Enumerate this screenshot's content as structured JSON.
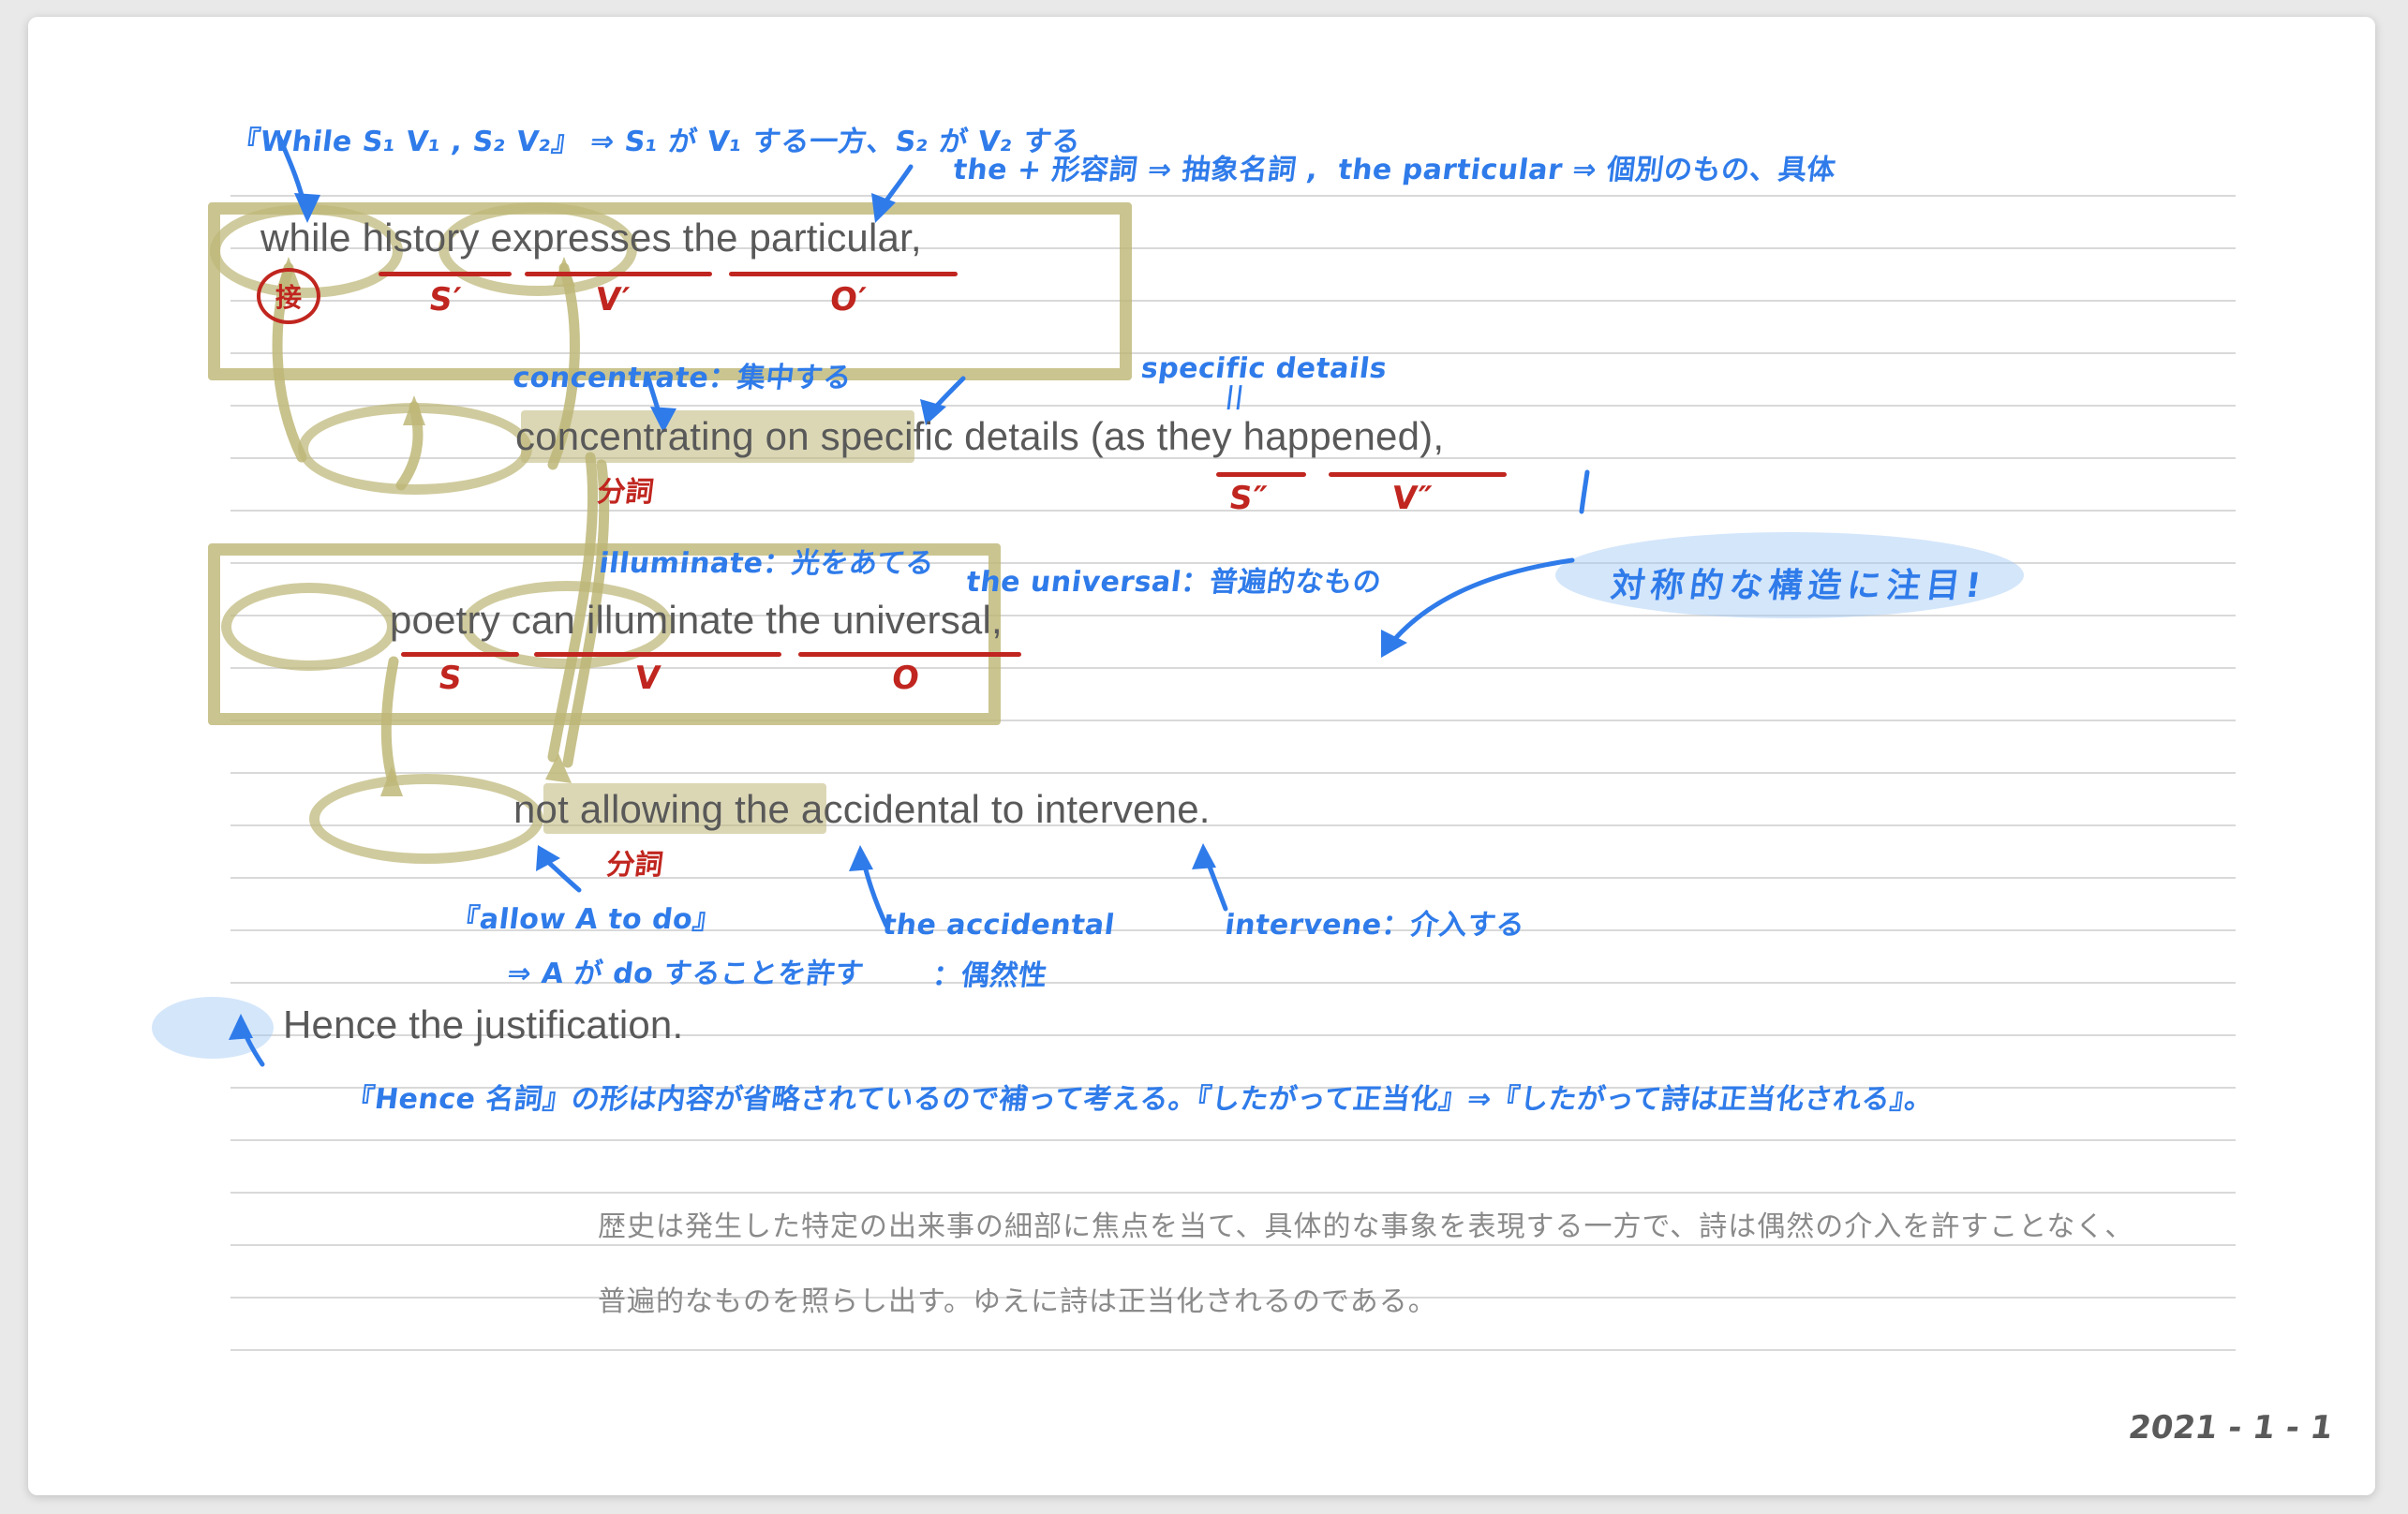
{
  "document": {
    "date": "2021 - 1 - 1",
    "stamp_label": "接"
  },
  "sentence_lines": [
    {
      "id": "line1",
      "text": "while history expresses the particular,"
    },
    {
      "id": "line2",
      "text": "concentrating on specific details (as they happened),"
    },
    {
      "id": "line3",
      "text": "poetry can illuminate the universal,"
    },
    {
      "id": "line4",
      "text": "not allowing the accidental to intervene."
    },
    {
      "id": "line5",
      "text": "Hence the justification."
    }
  ],
  "grammar_labels": {
    "s_prime": "S′",
    "v_prime": "V′",
    "o_prime": "O′",
    "s_double": "S″",
    "v_double": "V″",
    "s": "S",
    "v": "V",
    "o": "O",
    "participle_1": "分詞",
    "participle_2": "分詞"
  },
  "annotations": {
    "while_pattern": "『While S₁ V₁ , S₂ V₂』 ⇒ S₁ が V₁ する一方、S₂ が V₂ する",
    "the_adjective": "the + 形容詞 ⇒ 抽象名詞 ,  the particular ⇒ 個別のもの、具体",
    "concentrate": "concentrate：集中する",
    "specific_details": "specific details",
    "equals_sign": "||",
    "illuminate": "illuminate：光をあてる",
    "the_universal": "the universal：普遍的なもの",
    "symmetry_note": "対称的な構造に注目!",
    "allow_pattern": "『allow A to do』",
    "allow_meaning": "⇒ A が do することを許す",
    "the_accidental": "the accidental",
    "the_accidental_meaning": "：偶然性",
    "intervene": "intervene：介入する",
    "hence_note": "『Hence 名詞』の形は内容が省略されているので補って考える。『したがって正当化』⇒『したがって詩は正当化される』。"
  },
  "translation": {
    "line1": "歴史は発生した特定の出来事の細部に焦点を当て、具体的な事象を表現する一方で、詩は偶然の介入を許すことなく、",
    "line2": "普遍的なものを照らし出す。ゆえに詩は正当化されるのである。"
  },
  "colors": {
    "ink_blue": "#2f7bea",
    "ink_red": "#c0261f",
    "highlight_olive": "#beb778",
    "highlight_blue": "#a0c8f5",
    "body_text": "#595959",
    "rule_line": "#d9d9d9"
  }
}
